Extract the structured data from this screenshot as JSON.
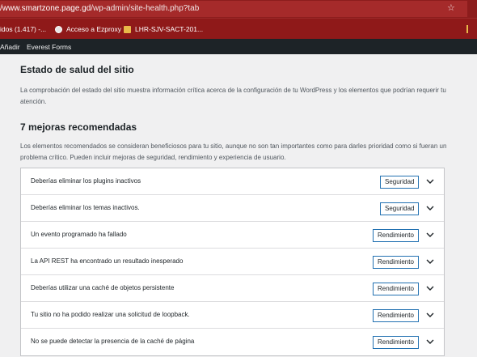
{
  "browser": {
    "url_host": "/www.smartzone.page.gd",
    "url_path": "/wp-admin/site-health.php?tab",
    "bookmarks": [
      {
        "label": "idos (1.417) -...",
        "icon": "folder-icon"
      },
      {
        "label": "Acceso a Ezproxy",
        "icon": "globe-icon"
      },
      {
        "label": "LHR-SJV-SACT-201...",
        "icon": "folder-icon"
      }
    ]
  },
  "adminbar": {
    "items": [
      "Añadir",
      "Everest Forms"
    ]
  },
  "page": {
    "title": "Estado de salud del sitio",
    "description": "La comprobación del estado del sitio muestra información crítica acerca de la configuración de tu WordPress y los elementos que podrían requerir tu atención."
  },
  "recommended": {
    "heading": "7 mejoras recomendadas",
    "description": "Los elementos recomendados se consideran beneficiosos para tu sitio, aunque no son tan importantes como para darles prioridad como si fueran un problema crítico. Pueden incluir mejoras de seguridad, rendimiento y experiencia de usuario.",
    "items": [
      {
        "label": "Deberías eliminar los plugins inactivos",
        "badge": "Seguridad"
      },
      {
        "label": "Deberías eliminar los temas inactivos.",
        "badge": "Seguridad"
      },
      {
        "label": "Un evento programado ha fallado",
        "badge": "Rendimiento"
      },
      {
        "label": "La API REST ha encontrado un resultado inesperado",
        "badge": "Rendimiento"
      },
      {
        "label": "Deberías utilizar una caché de objetos persistente",
        "badge": "Rendimiento"
      },
      {
        "label": "Tu sitio no ha podido realizar una solicitud de loopback.",
        "badge": "Rendimiento"
      },
      {
        "label": "No se puede detectar la presencia de la caché de página",
        "badge": "Rendimiento"
      }
    ]
  },
  "colors": {
    "browser_chrome": "#8f1919",
    "adminbar": "#1d2327",
    "badge_border": "#2271b1"
  }
}
